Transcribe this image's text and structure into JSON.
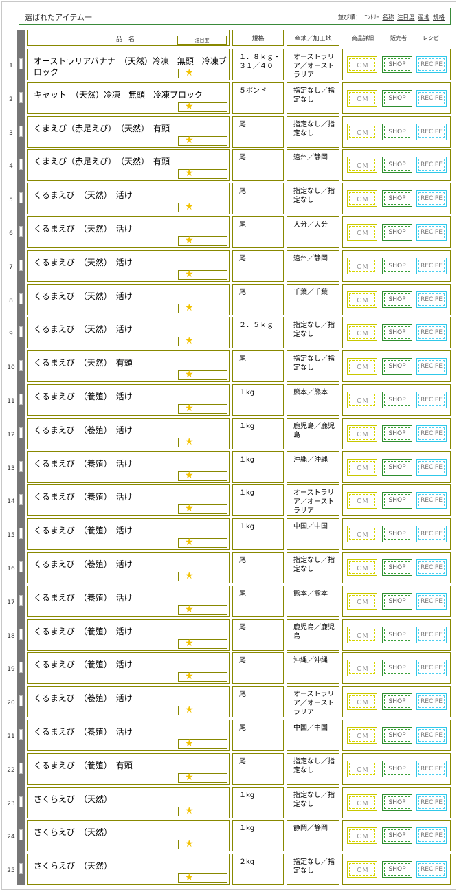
{
  "header": {
    "title": "選ばれたアイテム一",
    "sort_label": "並び順：",
    "sort_entry": "ｴﾝﾄﾘｰ",
    "sort_name": "名称",
    "sort_attention": "注目度",
    "sort_origin": "産地",
    "sort_spec": "規格"
  },
  "columns": {
    "name": "品　名",
    "attention": "注目度",
    "spec": "規格",
    "origin": "産地／加工地",
    "detail": "商品詳細",
    "seller": "販売者",
    "recipe": "レシピ"
  },
  "buttons": {
    "cm": "ＣＭ",
    "shop": "SHOP",
    "recipe": "RECIPE"
  },
  "colors": {
    "frame": "#888800",
    "cm": "#c8c800",
    "shop": "#2f8f2f",
    "recipe": "#30c8e8",
    "star": "#f2c200",
    "side_bar": "#777777",
    "title_border": "#3a8a3a"
  },
  "items": [
    {
      "no": "1",
      "name": "オーストラリアバナナ　（天然）冷凍　無頭　冷凍ブロック",
      "spec": "１．８ｋｇ・３１／４０",
      "origin": "オーストラリア／オーストラリア",
      "star": "★"
    },
    {
      "no": "2",
      "name": "キャット　（天然）冷凍　無頭　冷凍ブロック",
      "spec": "５ポンド",
      "origin": "指定なし／指定なし",
      "star": "★"
    },
    {
      "no": "3",
      "name": "くまえび（赤足えび）　（天然）　有頭",
      "spec": "尾",
      "origin": "指定なし／指定なし",
      "star": "★"
    },
    {
      "no": "4",
      "name": "くまえび（赤足えび）　（天然）　有頭",
      "spec": "尾",
      "origin": "遠州／静岡",
      "star": "★"
    },
    {
      "no": "5",
      "name": "くるまえび　（天然）　活け",
      "spec": "尾",
      "origin": "指定なし／指定なし",
      "star": "★"
    },
    {
      "no": "6",
      "name": "くるまえび　（天然）　活け",
      "spec": "尾",
      "origin": "大分／大分",
      "star": "★"
    },
    {
      "no": "7",
      "name": "くるまえび　（天然）　活け",
      "spec": "尾",
      "origin": "遠州／静岡",
      "star": "★"
    },
    {
      "no": "8",
      "name": "くるまえび　（天然）　活け",
      "spec": "尾",
      "origin": "千葉／千葉",
      "star": "★"
    },
    {
      "no": "9",
      "name": "くるまえび　（天然）　活け",
      "spec": "２．５ｋｇ",
      "origin": "指定なし／指定なし",
      "star": "★"
    },
    {
      "no": "10",
      "name": "くるまえび　（天然）　有頭",
      "spec": "尾",
      "origin": "指定なし／指定なし",
      "star": "★"
    },
    {
      "no": "11",
      "name": "くるまえび　（養殖）　活け",
      "spec": "１kg",
      "origin": "熊本／熊本",
      "star": "★"
    },
    {
      "no": "12",
      "name": "くるまえび　（養殖）　活け",
      "spec": "１kg",
      "origin": "鹿児島／鹿児島",
      "star": "★"
    },
    {
      "no": "13",
      "name": "くるまえび　（養殖）　活け",
      "spec": "１kg",
      "origin": "沖縄／沖縄",
      "star": "★"
    },
    {
      "no": "14",
      "name": "くるまえび　（養殖）　活け",
      "spec": "１kg",
      "origin": "オーストラリア／オーストラリア",
      "star": "★"
    },
    {
      "no": "15",
      "name": "くるまえび　（養殖）　活け",
      "spec": "１kg",
      "origin": "中国／中国",
      "star": "★"
    },
    {
      "no": "16",
      "name": "くるまえび　（養殖）　活け",
      "spec": "尾",
      "origin": "指定なし／指定なし",
      "star": "★"
    },
    {
      "no": "17",
      "name": "くるまえび　（養殖）　活け",
      "spec": "尾",
      "origin": "熊本／熊本",
      "star": "★"
    },
    {
      "no": "18",
      "name": "くるまえび　（養殖）　活け",
      "spec": "尾",
      "origin": "鹿児島／鹿児島",
      "star": "★"
    },
    {
      "no": "19",
      "name": "くるまえび　（養殖）　活け",
      "spec": "尾",
      "origin": "沖縄／沖縄",
      "star": "★"
    },
    {
      "no": "20",
      "name": "くるまえび　（養殖）　活け",
      "spec": "尾",
      "origin": "オーストラリア／オーストラリア",
      "star": "★"
    },
    {
      "no": "21",
      "name": "くるまえび　（養殖）　活け",
      "spec": "尾",
      "origin": "中国／中国",
      "star": "★"
    },
    {
      "no": "22",
      "name": "くるまえび　（養殖）　有頭",
      "spec": "尾",
      "origin": "指定なし／指定なし",
      "star": "★"
    },
    {
      "no": "23",
      "name": "さくらえび　（天然）",
      "spec": "１kg",
      "origin": "指定なし／指定なし",
      "star": "★"
    },
    {
      "no": "24",
      "name": "さくらえび　（天然）",
      "spec": "１kg",
      "origin": "静岡／静岡",
      "star": "★"
    },
    {
      "no": "25",
      "name": "さくらえび　（天然）",
      "spec": "２kg",
      "origin": "指定なし／指定なし",
      "star": "★"
    }
  ]
}
